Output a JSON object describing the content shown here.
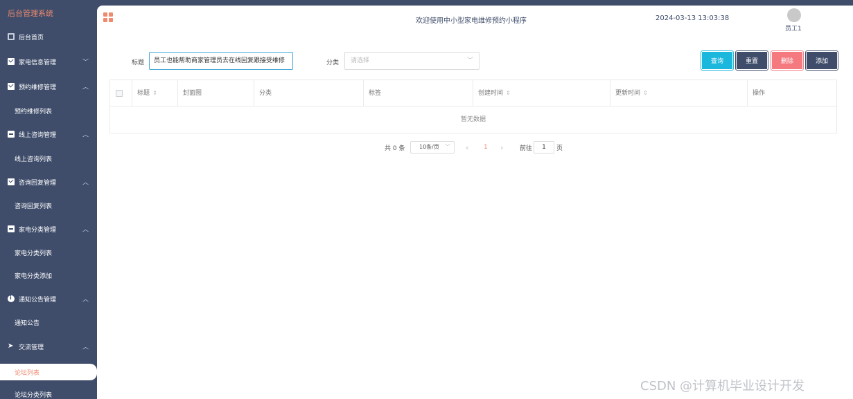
{
  "sidebar": {
    "brand": "后台管理系统",
    "items": [
      {
        "label": "后台首页",
        "icon": "monitor-icon",
        "chevron": ""
      },
      {
        "label": "家电信息管理",
        "icon": "checkbox-icon",
        "chevron": "﹀"
      },
      {
        "label": "预约维修管理",
        "icon": "checkbox-icon",
        "chevron": "︿"
      },
      {
        "label": "预约维修列表",
        "sub": true
      },
      {
        "label": "线上咨询管理",
        "icon": "minus-square-icon",
        "chevron": "︿"
      },
      {
        "label": "线上咨询列表",
        "sub": true
      },
      {
        "label": "咨询回复管理",
        "icon": "checkbox-icon",
        "chevron": "︿"
      },
      {
        "label": "咨询回复列表",
        "sub": true
      },
      {
        "label": "家电分类管理",
        "icon": "minus-square-icon",
        "chevron": "︿"
      },
      {
        "label": "家电分类列表",
        "sub": true
      },
      {
        "label": "家电分类添加",
        "sub": true
      },
      {
        "label": "通知公告管理",
        "icon": "info-icon",
        "chevron": "︿"
      },
      {
        "label": "通知公告",
        "sub": true
      },
      {
        "label": "交流管理",
        "icon": "plane-icon",
        "chevron": "︿"
      },
      {
        "label": "论坛列表",
        "sub": true,
        "active": true
      },
      {
        "label": "论坛分类列表",
        "sub": true
      }
    ]
  },
  "header": {
    "title": "欢迎使用中小型家电维修预约小程序",
    "datetime": "2024-03-13 13:03:38",
    "user": "员工1"
  },
  "filter": {
    "title_label": "标题",
    "title_value": "员工也能帮助商家管理员去在线回复跟接受维修",
    "category_label": "分类",
    "category_placeholder": "请选择",
    "query_btn": "查询",
    "reset_btn": "重置",
    "delete_btn": "删除",
    "add_btn": "添加"
  },
  "table": {
    "columns": [
      "标题",
      "封面图",
      "分类",
      "标签",
      "创建时间",
      "更新时间",
      "操作"
    ],
    "empty_text": "暂无数据"
  },
  "pagination": {
    "total": "共 0 条",
    "page_size": "10条/页",
    "prev": "‹",
    "current": "1",
    "next": "›",
    "goto_label": "前往",
    "goto_value": "1",
    "page_suffix": "页"
  },
  "watermark": "CSDN @计算机毕业设计开发",
  "colors": {
    "sidebar_bg": "#3f4d6b",
    "accent": "#f08a6e",
    "query": "#1bb7dc",
    "delete": "#f47a80"
  }
}
